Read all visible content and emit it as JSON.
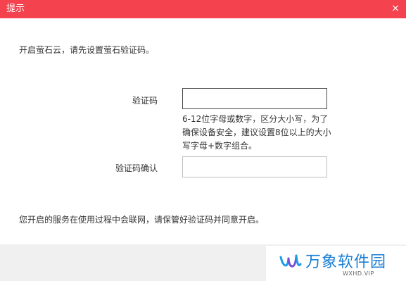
{
  "dialog": {
    "title": "提示",
    "close_glyph": "×"
  },
  "main": {
    "intro": "开启萤石云，请先设置萤石验证码。",
    "code_label": "验证码",
    "code_value": "",
    "hint": "6-12位字母或数字，区分大小写，为了确保设备安全，建议设置8位以上的大小写字母+数字组合。",
    "confirm_label": "验证码确认",
    "confirm_value": "",
    "notice": "您开启的服务在使用过程中会联网，请保管好验证码并同意开启。"
  },
  "watermark": {
    "name": "万象软件园",
    "url": "WXHD.VIP"
  },
  "colors": {
    "titlebar": "#f4424f",
    "text": "#333333",
    "watermark": "#1a7fd4"
  },
  "icons": {
    "close": "close-icon",
    "logo": "wanxiang-logo-icon"
  }
}
